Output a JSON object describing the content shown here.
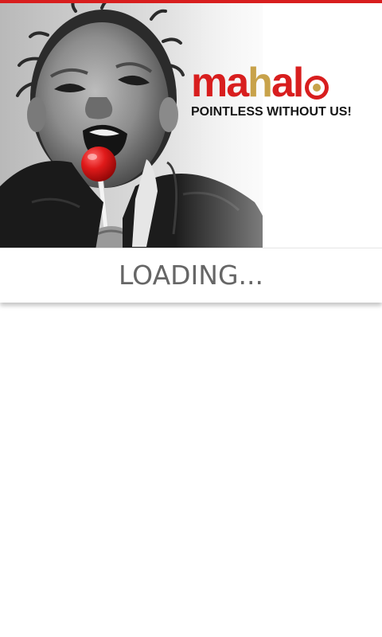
{
  "app": {
    "accent_color": "#d81e1e",
    "gold_color": "#c8a24a"
  },
  "hero": {
    "image_subject": "child-with-red-lollipop-photo"
  },
  "logo": {
    "letters": [
      {
        "char": "m",
        "color": "#d81e1e"
      },
      {
        "char": "a",
        "color": "#d81e1e"
      },
      {
        "char": "h",
        "color": "#c8a24a"
      },
      {
        "char": "a",
        "color": "#d81e1e"
      },
      {
        "char": "l",
        "color": "#d81e1e"
      }
    ],
    "target_ring_color": "#d81e1e",
    "target_center_color": "#c8a24a",
    "tagline": "POINTLESS WITHOUT US!"
  },
  "status": {
    "loading_text": "LOADING..."
  }
}
